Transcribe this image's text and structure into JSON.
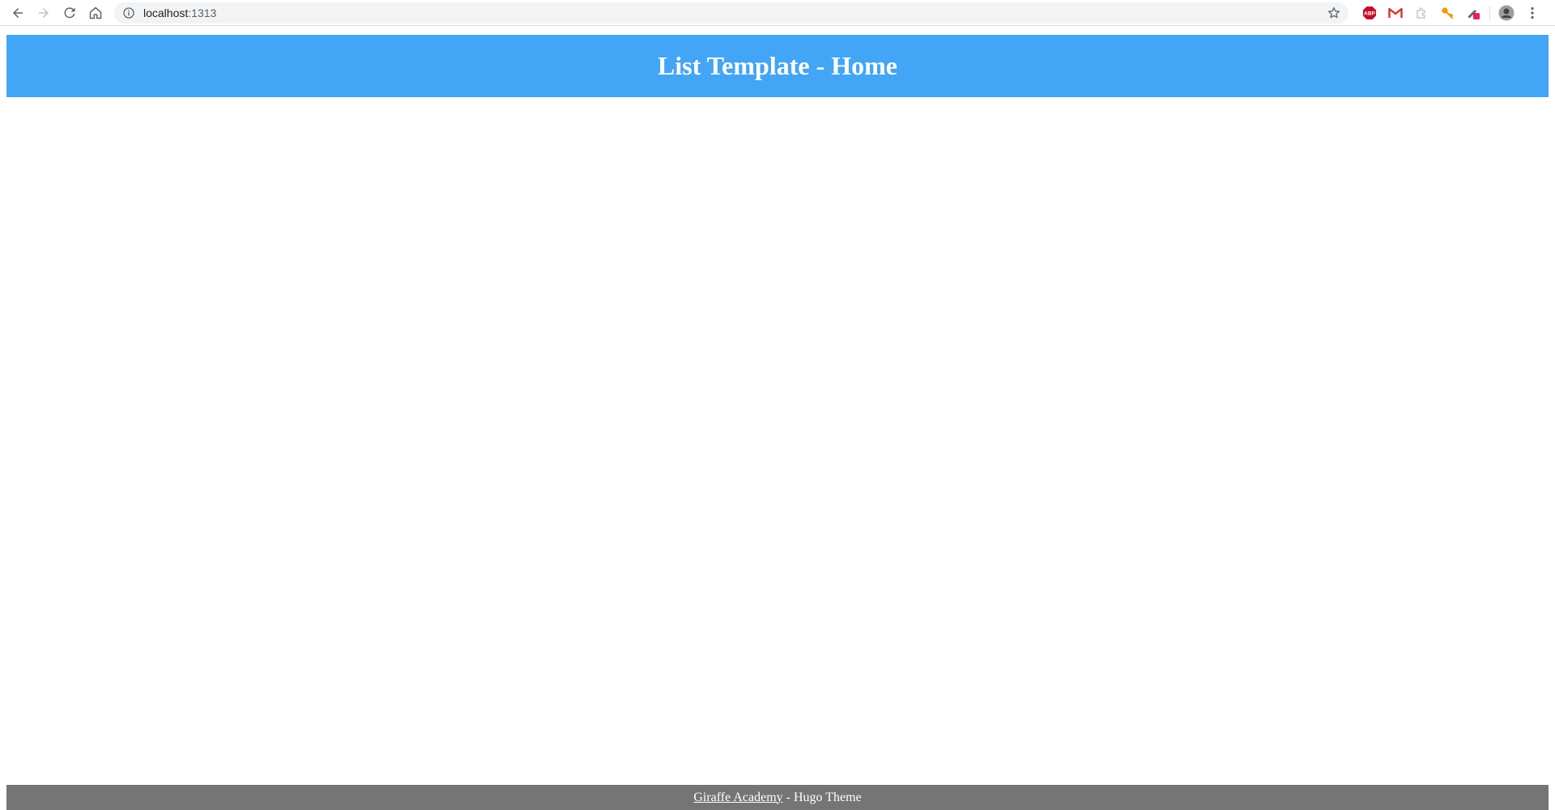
{
  "browser": {
    "url_host": "localhost",
    "url_port": ":1313",
    "icons": {
      "back": "back-arrow-icon",
      "forward": "forward-arrow-icon",
      "reload": "reload-icon",
      "home": "home-icon",
      "info": "info-icon",
      "bookmark": "star-icon",
      "menu": "kebab-menu-icon"
    },
    "extensions": [
      {
        "name": "adblock-extension-icon",
        "label": "ABP",
        "color": "#c70d2c"
      },
      {
        "name": "gmail-extension-icon",
        "label": "M",
        "color": "#d93025"
      },
      {
        "name": "puzzle-extension-icon",
        "label": "",
        "color": "#bdbdbd"
      },
      {
        "name": "key-extension-icon",
        "label": "",
        "color": "#f29900"
      },
      {
        "name": "eyedropper-extension-icon",
        "label": "",
        "color": "#e91e63"
      }
    ]
  },
  "header": {
    "title": "List Template - Home",
    "background_color": "#42a5f5"
  },
  "footer": {
    "link_text": "Giraffe Academy",
    "suffix": " - Hugo Theme",
    "background_color": "#757575"
  }
}
